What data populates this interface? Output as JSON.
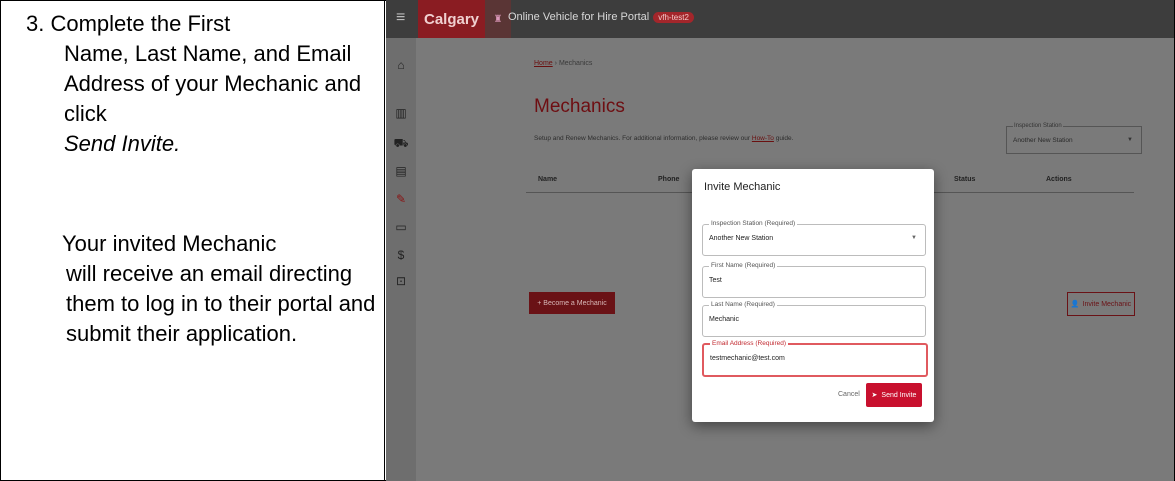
{
  "instructions": {
    "step_number": "3.",
    "step_line1": "Complete the First",
    "step_body": "Name, Last Name, and Email Address of your Mechanic and click",
    "step_action": "Send Invite.",
    "note_line1": "Your invited Mechanic",
    "note_body": "will receive an email directing them to log in to their portal and submit their application."
  },
  "app": {
    "brand": "Calgary",
    "portal_title": "Online Vehicle for Hire Portal",
    "env_badge": "vfh-test2",
    "breadcrumb": {
      "home": "Home",
      "separator": "›",
      "current": "Mechanics"
    },
    "page_title": "Mechanics",
    "description_prefix": "Setup and Renew Mechanics. For additional information, please review our",
    "description_link": "How-To",
    "description_suffix": "guide.",
    "station_select": {
      "label": "Inspection Station",
      "value": "Another New Station"
    },
    "table_headers": [
      "Name",
      "Phone",
      "Status",
      "Actions"
    ],
    "become_button": "+ Become a Mechanic",
    "invite_button": "Invite Mechanic",
    "sidebar_icons": [
      "home-icon",
      "building-icon",
      "car-icon",
      "vehicle-icon",
      "wrench-icon",
      "card-icon",
      "dollar-icon",
      "lock-icon"
    ]
  },
  "dialog": {
    "title": "Invite Mechanic",
    "fields": {
      "station": {
        "label": "Inspection Station (Required)",
        "value": "Another New Station"
      },
      "first_name": {
        "label": "First Name (Required)",
        "value": "Test"
      },
      "last_name": {
        "label": "Last Name (Required)",
        "value": "Mechanic"
      },
      "email": {
        "label": "Email Address (Required)",
        "value": "testmechanic@test.com"
      }
    },
    "cancel": "Cancel",
    "send": "Send Invite"
  },
  "colors": {
    "brand_red": "#c8102e",
    "overlay": "#7b7b7b",
    "focus_border": "#e05a5f"
  }
}
